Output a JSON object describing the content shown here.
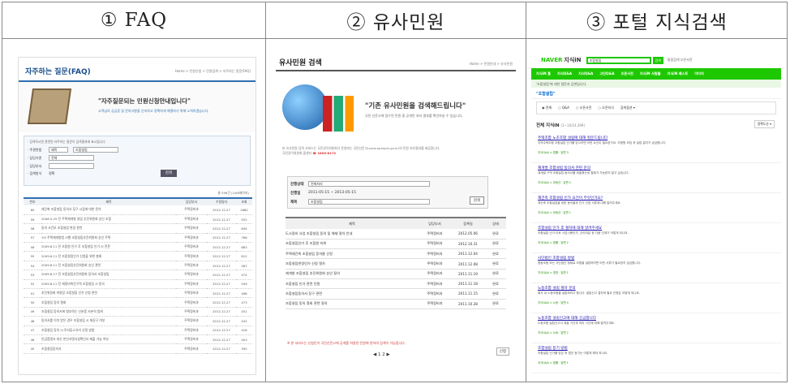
{
  "headers": [
    "① FAQ",
    "② 유사민원",
    "③ 포털 지식검색"
  ],
  "faq": {
    "title": "자주하는 질문(FAQ)",
    "crumb": "Home > 민원신청 > 민원검색 > 자주하는 질문(FAQ)",
    "slogan": "\"자주질문되는 민원신청안내입니다\"",
    "sub": "고객님의 궁금증 및 문의사항을 신속하고 정확하게 해결하기 위해 노력하겠습니다.",
    "search_note": "· 검색하시면 관련된 자주하는 질문이 검색결과에 표시됩니다",
    "labels": [
      "· 주관련법",
      "· 담당기관",
      "· 담당부서",
      "· 검색방식"
    ],
    "field_values": [
      "제목",
      "조합설립",
      "전체",
      "정확"
    ],
    "search_btn": "검색",
    "total": "총 596건 (1/60페이지)",
    "cols": [
      "번호",
      "제목",
      "담당부서",
      "수정일자",
      "조회"
    ],
    "rows": [
      [
        "60",
        "재건축 조합설립 동의서 징구 시점에 대한 문의",
        "주택정비과",
        "2012.12.27",
        "1682"
      ],
      [
        "59",
        "2006.5.25 전 주택재개발 설립 추진위원회 승인 조합",
        "주택정비과",
        "2012.12.27",
        "932"
      ],
      [
        "58",
        "동의 조건부 조합설립 변경 관련",
        "주택정비과",
        "2012.12.27",
        "845"
      ],
      [
        "57",
        "'05 주택재개발법 시행 조합설립추진위원회 승인 주택",
        "주택정비과",
        "2012.12.27",
        "766"
      ],
      [
        "56",
        "2009.8.11 전 조합원 인가 후 조합설립 인가 시 전문",
        "주택정비과",
        "2012.12.27",
        "683"
      ],
      [
        "55",
        "2009.8.11 전 조합설립인가 신청을 위한 총회",
        "주택정비과",
        "2012.12.27",
        "612"
      ],
      [
        "54",
        "2009.8.11 전 조합설립추진위원회 승인 관련",
        "주택정비과",
        "2012.12.27",
        "587"
      ],
      [
        "53",
        "2009.8.17 전 조합설립추진위원회 동의서 조합설립",
        "주택정비과",
        "2012.12.27",
        "574"
      ],
      [
        "52",
        "2009.8.11 전 재정비촉진구역 조합설립 시 동의",
        "주택정비과",
        "2012.12.27",
        "549"
      ],
      [
        "51",
        "추진위원회 위원장 조합설립 인가 신청 관련",
        "주택정비과",
        "2012.12.27",
        "498"
      ],
      [
        "50",
        "조합설립 동의 철회",
        "주택정비과",
        "2012.12.27",
        "473"
      ],
      [
        "49",
        "조합설립 동의서에 첨부하는 신분증 사본의 범위",
        "주택정비과",
        "2012.12.27",
        "451"
      ],
      [
        "48",
        "동의서를 이미 받은 경우 조합설립 시 재징구 여부",
        "주택정비과",
        "2012.12.27",
        "432"
      ],
      [
        "47",
        "조합설립 동의 시 토지등소유자 산정 방법",
        "주택정비과",
        "2012.12.27",
        "418"
      ],
      [
        "46",
        "인감증명서 대신 본인서명사실확인서 제출 가능 여부",
        "주택정비과",
        "2012.12.27",
        "403"
      ],
      [
        "45",
        "조합설립동의서",
        "주택정비과",
        "2012.12.27",
        "392"
      ]
    ]
  },
  "similar": {
    "title": "유사민원 검색",
    "crumb": "Home > 민원안내 > 유사민원",
    "slogan": "\"기존 유사민원을 검색해드립니다\"",
    "sub": "국민 신문고에 접수된 민원 중 공개된 처리 결과를 확인하실 수 있습니다.",
    "info": "본 유사민원 검색 서비스는 국민권익위원회가 운영하는 국민신문고(www.epeople.go.kr)의 민원 처리결과를 제공합니다.",
    "phone_label": "국민권익위원회 콜센터",
    "phone": "☎ 1600-8172",
    "labels": [
      "진행상태",
      "진행일",
      "제목"
    ],
    "status_value": "전체처리",
    "date_value": "2011-05-15 ~ 2013-05-15",
    "keyword": "조합설립",
    "search_btn": "검색",
    "cols": [
      "제목",
      "담당부서",
      "등록일",
      "상태"
    ],
    "rows": [
      [
        "도시정비 사업 조합설립 동의 및 해제 절차 안내",
        "주택정비과",
        "2012.05.06",
        "완료"
      ],
      [
        "조합설립인가 후 조합원 지위",
        "주택정비과",
        "2012.10.31",
        "완료"
      ],
      [
        "주택재건축 조합설립 동의율 산정",
        "주택정비과",
        "2011.12.04",
        "완료"
      ],
      [
        "조합설립변경인가 신청 절차",
        "주택정비과",
        "2011.12.08",
        "완료"
      ],
      [
        "재개발 조합설립 추진위원회 승인 질의",
        "주택정비과",
        "2011.11.19",
        "완료"
      ],
      [
        "조합설립 인가 관련 민원",
        "주택정비과",
        "2011.11.18",
        "완료"
      ],
      [
        "조합설립동의서 징구 관련",
        "주택정비과",
        "2011.11.15",
        "완료"
      ],
      [
        "조합설립 동의 철회 관련 질의",
        "주택정비과",
        "2011.10.28",
        "완료"
      ]
    ],
    "note": "※ 본 서비스는 신청인이 국민신문고에 공개를 허용한 민원에 한하여 검색이 가능합니다.",
    "pager": "◀ 1 2 ▶",
    "apply": "신청"
  },
  "naver": {
    "logo": "NAVER",
    "logo2": "지식iN",
    "query": "조합설립",
    "search_btn": "검색",
    "links": "통합검색 오픈사전",
    "menu": [
      "지식iN 홈",
      "지식Q&A",
      "지식Q&A",
      "고민Q&A",
      "오픈사전",
      "지식iN 사람들",
      "지식iN 베스트",
      "이미지"
    ],
    "sub": "'조합설립'에 대한 질문과 답변입니다.",
    "word": "\"조합설립\"",
    "opts": [
      "◉ 전체",
      "○ Q&A",
      "○ 오픈사전",
      "○ 오픈지식",
      "검색옵션 ▾"
    ],
    "result_title": "전체 지식iN",
    "result_count": "(1~10/14,399)",
    "sort": "정확도순 ▾",
    "items": [
      {
        "t": "주택조합 노조조합 설립에 대해 질문드립니다",
        "d": "지역주택조합 조합설립 인가를 받으려면 어떤 요건이 필요한가요. 조합원 모집 후 설립 절차가 궁금합니다.",
        "m": "지식Q&A > 법률 · 답변 3"
      },
      {
        "t": "재개발 조합설립 동의서 관련 문의",
        "d": "재개발 구역 조합설립 동의서를 제출했는데 철회가 가능한지 알고 싶습니다.",
        "m": "지식Q&A > 부동산 · 답변 2"
      },
      {
        "t": "재건축 조합설립 인가 요건이 무엇인가요?",
        "d": "재건축 조합설립을 위한 동의율과 인가 신청 서류에 대해 알려주세요.",
        "m": "지식Q&A > 부동산 · 답변 1"
      },
      {
        "t": "조합설립 인가 후 절차에 대해 알려주세요",
        "d": "조합설립 인가 이후 사업시행인가, 관리처분 등 다음 단계가 어떻게 되나요.",
        "m": "지식Q&A > 법률 · 답변 2"
      },
      {
        "t": "사단법인 조합설립 방법",
        "d": "협동조합 또는 사단법인 형태로 조합을 설립하려면 어떤 서류가 필요한지 궁금합니다.",
        "m": "지식Q&A > 경영 · 답변 1"
      },
      {
        "t": "노동조합 설립 절차 문의",
        "d": "회사 내 노동조합을 설립하려고 합니다. 설립신고 절차와 필요 인원은 어떻게 되나요.",
        "m": "지식Q&A > 노동 · 답변 4"
      },
      {
        "t": "노동조합 설립신고에 대해 궁금합니다",
        "d": "노동조합 설립신고서 제출 기관과 처리 기간에 대해 알려주세요.",
        "m": "지식Q&A > 노동 · 답변 2"
      },
      {
        "t": "조합설립 등기 방법",
        "d": "조합설립 인가를 받은 후 법인 등기는 어떻게 해야 하나요.",
        "m": "지식Q&A > 법률 · 답변 1"
      }
    ]
  }
}
